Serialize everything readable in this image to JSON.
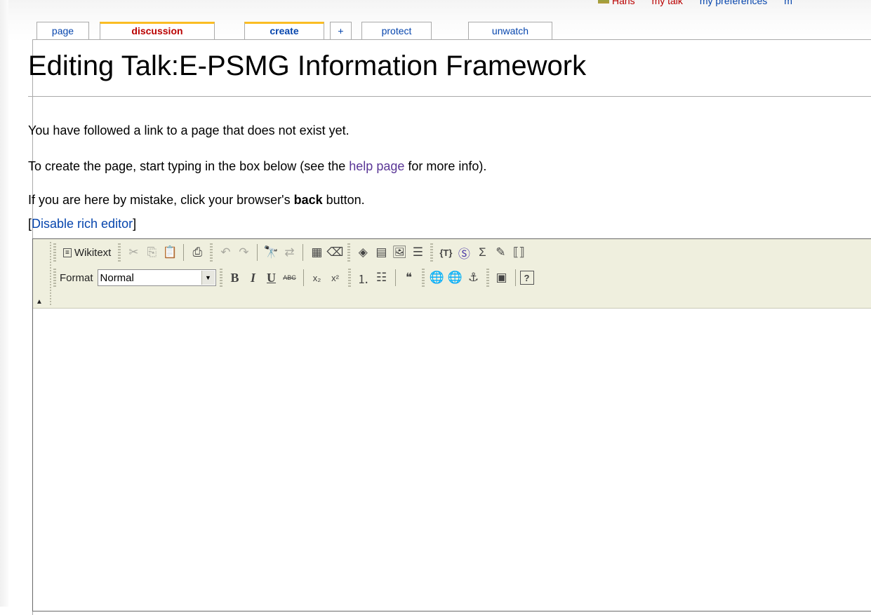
{
  "personal": {
    "user": "Hans",
    "talk": "my talk",
    "preferences": "my preferences",
    "more": "m"
  },
  "tabs": [
    {
      "label": "page"
    },
    {
      "label": "discussion"
    },
    {
      "label": "create"
    },
    {
      "label": "+"
    },
    {
      "label": "protect"
    },
    {
      "label": "unwatch"
    }
  ],
  "title": "Editing Talk:E-PSMG Information Framework",
  "intro": {
    "line1": "You have followed a link to a page that does not exist yet.",
    "line2_pre": "To create the page, start typing in the box below (see the ",
    "line2_link": "help page",
    "line2_post": " for more info).",
    "line3_pre": "If you are here by mistake, click your browser's ",
    "line3_bold": "back",
    "line3_post": " button.",
    "disable_open": "[",
    "disable_link": "Disable rich editor",
    "disable_close": "]"
  },
  "toolbar": {
    "wikitext_label": "Wikitext",
    "format_label": "Format",
    "format_value": "Normal",
    "bold": "B",
    "italic": "I",
    "underline": "U",
    "strike": "ABC",
    "subscript": "x₂",
    "superscript": "x²",
    "quote": "❝",
    "sigma": "Σ",
    "template": "{T}",
    "signature": "Ⓢ",
    "help": "?"
  }
}
